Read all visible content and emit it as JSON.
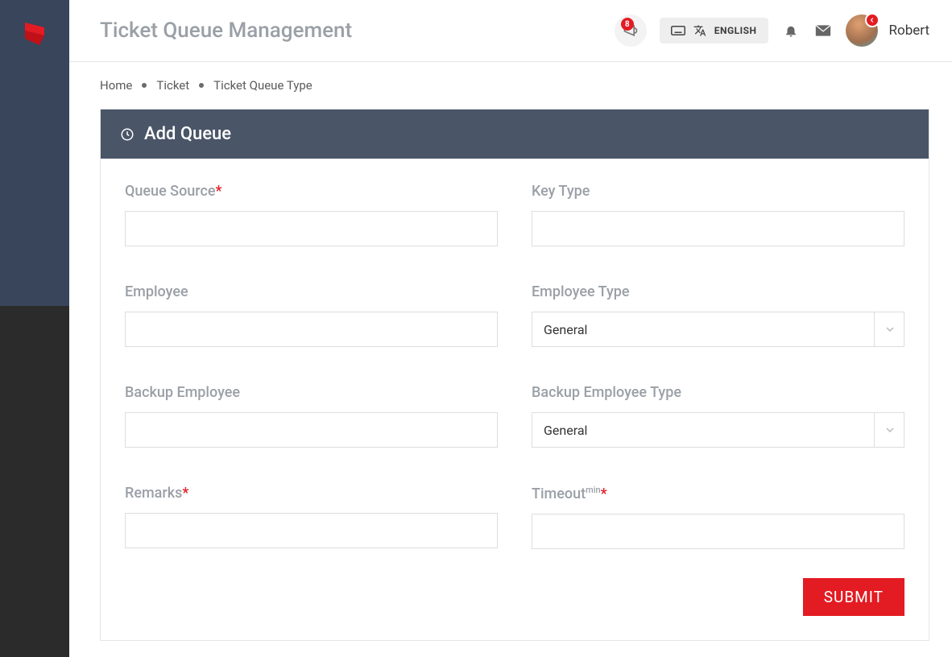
{
  "header": {
    "title": "Ticket Queue Management",
    "notifications_count": "8",
    "lang_label": "ENGLISH",
    "user_name": "Robert"
  },
  "breadcrumb": {
    "items": [
      "Home",
      "Ticket",
      "Ticket Queue Type"
    ]
  },
  "panel": {
    "title": "Add Queue"
  },
  "form": {
    "queue_source_label": "Queue Source",
    "queue_source_value": "",
    "key_type_label": "Key Type",
    "key_type_value": "",
    "employee_label": "Employee",
    "employee_value": "",
    "employee_type_label": "Employee Type",
    "employee_type_value": "General",
    "backup_employee_label": "Backup Employee",
    "backup_employee_value": "",
    "backup_employee_type_label": "Backup Employee Type",
    "backup_employee_type_value": "General",
    "remarks_label": "Remarks",
    "remarks_value": "",
    "timeout_label": "Timeout",
    "timeout_sup": "min",
    "timeout_value": "",
    "submit_label": "SUBMIT"
  }
}
